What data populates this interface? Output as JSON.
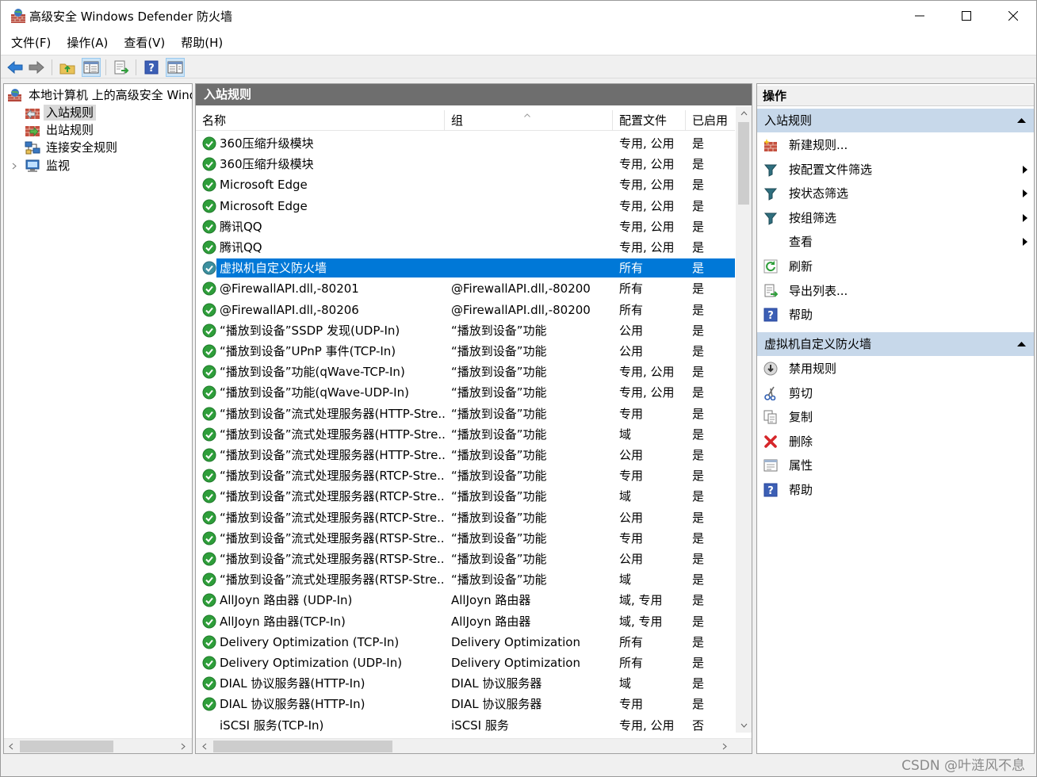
{
  "window": {
    "title": "高级安全 Windows Defender 防火墙"
  },
  "menu": [
    "文件(F)",
    "操作(A)",
    "查看(V)",
    "帮助(H)"
  ],
  "tree": {
    "root": "本地计算机 上的高级安全 Windows Defender 防火墙",
    "items": [
      {
        "label": "入站规则",
        "selected": true
      },
      {
        "label": "出站规则",
        "selected": false
      },
      {
        "label": "连接安全规则",
        "selected": false
      },
      {
        "label": "监视",
        "selected": false
      }
    ]
  },
  "center": {
    "header": "入站规则",
    "columns": [
      "名称",
      "组",
      "配置文件",
      "已启用"
    ],
    "rows": [
      {
        "name": "360压缩升级模块",
        "group": "",
        "profile": "专用, 公用",
        "enabled": "是",
        "icon": "allow"
      },
      {
        "name": "360压缩升级模块",
        "group": "",
        "profile": "专用, 公用",
        "enabled": "是",
        "icon": "allow"
      },
      {
        "name": "Microsoft Edge",
        "group": "",
        "profile": "专用, 公用",
        "enabled": "是",
        "icon": "allow"
      },
      {
        "name": "Microsoft Edge",
        "group": "",
        "profile": "专用, 公用",
        "enabled": "是",
        "icon": "allow"
      },
      {
        "name": "腾讯QQ",
        "group": "",
        "profile": "专用, 公用",
        "enabled": "是",
        "icon": "allow"
      },
      {
        "name": "腾讯QQ",
        "group": "",
        "profile": "专用, 公用",
        "enabled": "是",
        "icon": "allow"
      },
      {
        "name": "虚拟机自定义防火墙",
        "group": "",
        "profile": "所有",
        "enabled": "是",
        "icon": "allow",
        "selected": true
      },
      {
        "name": "@FirewallAPI.dll,-80201",
        "group": "@FirewallAPI.dll,-80200",
        "profile": "所有",
        "enabled": "是",
        "icon": "allow"
      },
      {
        "name": "@FirewallAPI.dll,-80206",
        "group": "@FirewallAPI.dll,-80200",
        "profile": "所有",
        "enabled": "是",
        "icon": "allow"
      },
      {
        "name": "“播放到设备”SSDP 发现(UDP-In)",
        "group": "“播放到设备”功能",
        "profile": "公用",
        "enabled": "是",
        "icon": "allow"
      },
      {
        "name": "“播放到设备”UPnP 事件(TCP-In)",
        "group": "“播放到设备”功能",
        "profile": "公用",
        "enabled": "是",
        "icon": "allow"
      },
      {
        "name": "“播放到设备”功能(qWave-TCP-In)",
        "group": "“播放到设备”功能",
        "profile": "专用, 公用",
        "enabled": "是",
        "icon": "allow"
      },
      {
        "name": "“播放到设备”功能(qWave-UDP-In)",
        "group": "“播放到设备”功能",
        "profile": "专用, 公用",
        "enabled": "是",
        "icon": "allow"
      },
      {
        "name": "“播放到设备”流式处理服务器(HTTP-Stre...",
        "group": "“播放到设备”功能",
        "profile": "专用",
        "enabled": "是",
        "icon": "allow"
      },
      {
        "name": "“播放到设备”流式处理服务器(HTTP-Stre...",
        "group": "“播放到设备”功能",
        "profile": "域",
        "enabled": "是",
        "icon": "allow"
      },
      {
        "name": "“播放到设备”流式处理服务器(HTTP-Stre...",
        "group": "“播放到设备”功能",
        "profile": "公用",
        "enabled": "是",
        "icon": "allow"
      },
      {
        "name": "“播放到设备”流式处理服务器(RTCP-Stre...",
        "group": "“播放到设备”功能",
        "profile": "专用",
        "enabled": "是",
        "icon": "allow"
      },
      {
        "name": "“播放到设备”流式处理服务器(RTCP-Stre...",
        "group": "“播放到设备”功能",
        "profile": "域",
        "enabled": "是",
        "icon": "allow"
      },
      {
        "name": "“播放到设备”流式处理服务器(RTCP-Stre...",
        "group": "“播放到设备”功能",
        "profile": "公用",
        "enabled": "是",
        "icon": "allow"
      },
      {
        "name": "“播放到设备”流式处理服务器(RTSP-Stre...",
        "group": "“播放到设备”功能",
        "profile": "专用",
        "enabled": "是",
        "icon": "allow"
      },
      {
        "name": "“播放到设备”流式处理服务器(RTSP-Stre...",
        "group": "“播放到设备”功能",
        "profile": "公用",
        "enabled": "是",
        "icon": "allow"
      },
      {
        "name": "“播放到设备”流式处理服务器(RTSP-Stre...",
        "group": "“播放到设备”功能",
        "profile": "域",
        "enabled": "是",
        "icon": "allow"
      },
      {
        "name": "AllJoyn 路由器 (UDP-In)",
        "group": "AllJoyn 路由器",
        "profile": "域, 专用",
        "enabled": "是",
        "icon": "allow"
      },
      {
        "name": "AllJoyn 路由器(TCP-In)",
        "group": "AllJoyn 路由器",
        "profile": "域, 专用",
        "enabled": "是",
        "icon": "allow"
      },
      {
        "name": "Delivery Optimization (TCP-In)",
        "group": "Delivery Optimization",
        "profile": "所有",
        "enabled": "是",
        "icon": "allow"
      },
      {
        "name": "Delivery Optimization (UDP-In)",
        "group": "Delivery Optimization",
        "profile": "所有",
        "enabled": "是",
        "icon": "allow"
      },
      {
        "name": "DIAL 协议服务器(HTTP-In)",
        "group": "DIAL 协议服务器",
        "profile": "域",
        "enabled": "是",
        "icon": "allow"
      },
      {
        "name": "DIAL 协议服务器(HTTP-In)",
        "group": "DIAL 协议服务器",
        "profile": "专用",
        "enabled": "是",
        "icon": "allow"
      },
      {
        "name": "iSCSI 服务(TCP-In)",
        "group": "iSCSI 服务",
        "profile": "专用, 公用",
        "enabled": "否",
        "icon": "none"
      }
    ]
  },
  "actions": {
    "title": "操作",
    "section1": {
      "title": "入站规则",
      "items": [
        {
          "label": "新建规则...",
          "icon": "new-rule-icon",
          "submenu": false
        },
        {
          "label": "按配置文件筛选",
          "icon": "filter-icon",
          "submenu": true
        },
        {
          "label": "按状态筛选",
          "icon": "filter-icon",
          "submenu": true
        },
        {
          "label": "按组筛选",
          "icon": "filter-icon",
          "submenu": true
        },
        {
          "label": "查看",
          "icon": "",
          "submenu": true
        },
        {
          "label": "刷新",
          "icon": "refresh-icon",
          "submenu": false
        },
        {
          "label": "导出列表...",
          "icon": "export-icon",
          "submenu": false
        },
        {
          "label": "帮助",
          "icon": "help-icon",
          "submenu": false
        }
      ]
    },
    "section2": {
      "title": "虚拟机自定义防火墙",
      "items": [
        {
          "label": "禁用规则",
          "icon": "disable-icon",
          "submenu": false
        },
        {
          "label": "剪切",
          "icon": "cut-icon",
          "submenu": false
        },
        {
          "label": "复制",
          "icon": "copy-icon",
          "submenu": false
        },
        {
          "label": "删除",
          "icon": "delete-icon",
          "submenu": false
        },
        {
          "label": "属性",
          "icon": "properties-icon",
          "submenu": false
        },
        {
          "label": "帮助",
          "icon": "help-icon",
          "submenu": false
        }
      ]
    }
  },
  "watermark": "CSDN @叶涟风不息",
  "colors": {
    "selection": "#0078d7",
    "section_bar": "#c7d8ea",
    "pane_header": "#6e6e6e",
    "allow_green": "#2e9e3a"
  }
}
